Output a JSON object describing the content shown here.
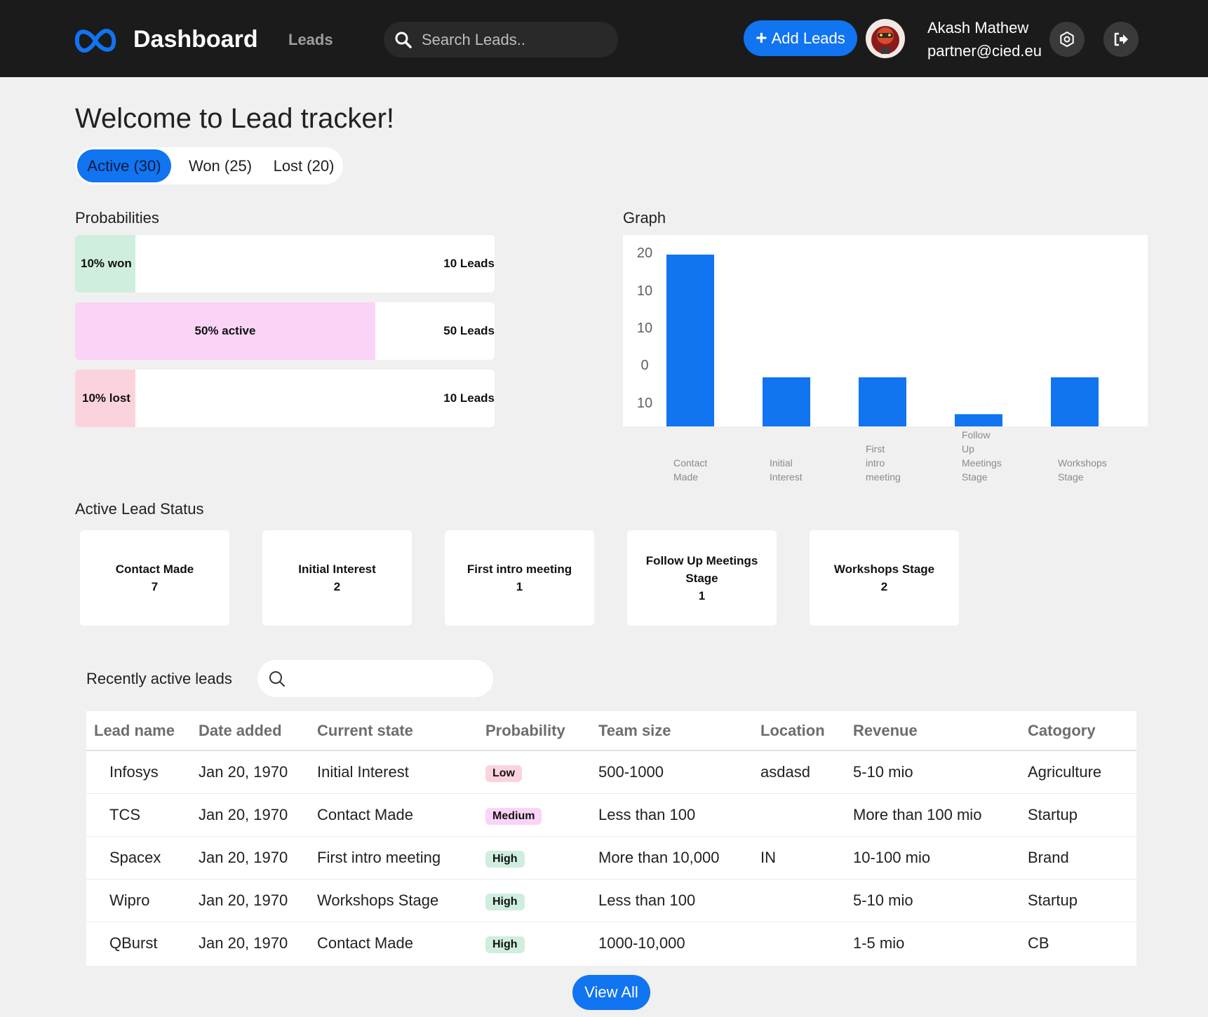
{
  "colors": {
    "accent": "#1174f0",
    "topbar": "#1b1b1b",
    "won": "#cfeede",
    "active": "#f9d4f6",
    "lost": "#fbd3dc"
  },
  "header": {
    "brand": "Dashboard",
    "nav_leads": "Leads",
    "search_placeholder": "Search Leads..",
    "add_button": "Add Leads",
    "user_name": "Akash Mathew",
    "user_email": "partner@cied.eu",
    "icons": [
      "logo-icon",
      "search-icon",
      "plus-icon",
      "avatar",
      "settings-icon",
      "logout-icon"
    ]
  },
  "welcome": "Welcome to Lead tracker!",
  "tabs": [
    {
      "label": "Active (30)",
      "active": true
    },
    {
      "label": "Won (25)",
      "active": false
    },
    {
      "label": "Lost (20)",
      "active": false
    }
  ],
  "probabilities": {
    "title": "Probabilities",
    "rows": [
      {
        "label": "10% won",
        "count": "10 Leads",
        "fraction": 0.1
      },
      {
        "label": "50% active",
        "count": "50 Leads",
        "fraction": 0.5
      },
      {
        "label": "10% lost",
        "count": "10 Leads",
        "fraction": 0.1
      }
    ]
  },
  "graph": {
    "title": "Graph"
  },
  "chart_data": {
    "type": "bar",
    "title": "",
    "xlabel": "",
    "ylabel": "",
    "y_tick_labels": [
      "20",
      "10",
      "10",
      "0",
      "10"
    ],
    "categories": [
      "Contact Made",
      "Initial Interest",
      "First intro meeting",
      "Follow Up Meetings Stage",
      "Workshops Stage"
    ],
    "category_labels": [
      "Contact\nMade",
      "Initial\nInterest",
      "First\nintro\nmeeting",
      "Follow\nUp\nMeetings\nStage",
      "Workshops\nStage"
    ],
    "values": [
      7,
      2,
      2,
      0.5,
      2
    ],
    "ylim": [
      0,
      7
    ],
    "bar_color": "#1174f0",
    "grid": false,
    "legend": "none"
  },
  "status": {
    "title": "Active Lead Status",
    "cards": [
      {
        "name": "Contact Made",
        "count": "7"
      },
      {
        "name": "Initial Interest",
        "count": "2"
      },
      {
        "name": "First intro meeting",
        "count": "1"
      },
      {
        "name": "Follow Up Meetings Stage",
        "count": "1"
      },
      {
        "name": "Workshops Stage",
        "count": "2"
      }
    ]
  },
  "recent": {
    "title": "Recently active leads",
    "search_placeholder": "",
    "columns": [
      "Lead name",
      "Date added",
      "Current state",
      "Probability",
      "Team size",
      "Location",
      "Revenue",
      "Catogory"
    ],
    "rows": [
      {
        "name": "Infosys",
        "date": "Jan 20, 1970",
        "state": "Initial Interest",
        "probability": "Low",
        "team": "500-1000",
        "location": "asdasd",
        "revenue": "5-10 mio",
        "category": "Agriculture"
      },
      {
        "name": "TCS",
        "date": "Jan 20, 1970",
        "state": "Contact Made",
        "probability": "Medium",
        "team": "Less than 100",
        "location": "",
        "revenue": "More than 100 mio",
        "category": "Startup"
      },
      {
        "name": "Spacex",
        "date": "Jan 20, 1970",
        "state": "First intro meeting",
        "probability": "High",
        "team": "More than 10,000",
        "location": "IN",
        "revenue": "10-100 mio",
        "category": "Brand"
      },
      {
        "name": "Wipro",
        "date": "Jan 20, 1970",
        "state": "Workshops Stage",
        "probability": "High",
        "team": "Less than 100",
        "location": "",
        "revenue": "5-10 mio",
        "category": "Startup"
      },
      {
        "name": "QBurst",
        "date": "Jan 20, 1970",
        "state": "Contact Made",
        "probability": "High",
        "team": "1000-10,000",
        "location": "",
        "revenue": "1-5 mio",
        "category": "CB"
      }
    ],
    "view_all": "View All"
  }
}
